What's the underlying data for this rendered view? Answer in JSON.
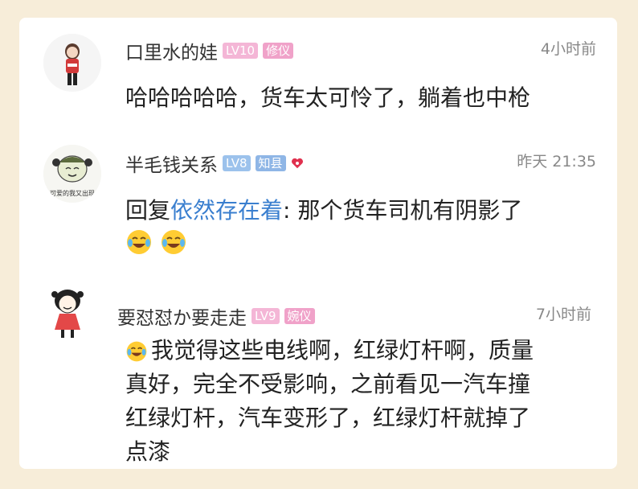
{
  "comments": [
    {
      "username": "口里水的娃",
      "level": "LV10",
      "title": "修仪",
      "time": "4小时前",
      "text": "哈哈哈哈哈，货车太可怜了，躺着也中枪"
    },
    {
      "username": "半毛钱关系",
      "level": "LV8",
      "title": "知县",
      "time": "昨天 21:35",
      "reply_prefix": "回复",
      "reply_to": "依然存在着",
      "text": ": 那个货车司机有阴影了",
      "avatar_caption": "可爱的我又出现"
    },
    {
      "username": "要怼怼か要走走",
      "level": "LV9",
      "title": "婉仪",
      "time": "7小时前",
      "text_lines": [
        "我觉得这些电线啊，红绿灯杆啊，质量",
        "真好，完全不受影响，之前看见一汽车撞",
        "红绿灯杆，汽车变形了，红绿灯杆就掉了",
        "点漆"
      ]
    }
  ],
  "colors": {
    "background": "#f7edd9",
    "card": "#ffffff",
    "lv_blue": "#9cc2ec",
    "lv_pink": "#f4b6d6",
    "title_pink": "#f0a2c9",
    "title_blue": "#8fb6e6",
    "reply_link": "#3a7fcf"
  },
  "icons": {
    "emoji": "laughing-tears-emoji",
    "heart": "heart-icon"
  }
}
